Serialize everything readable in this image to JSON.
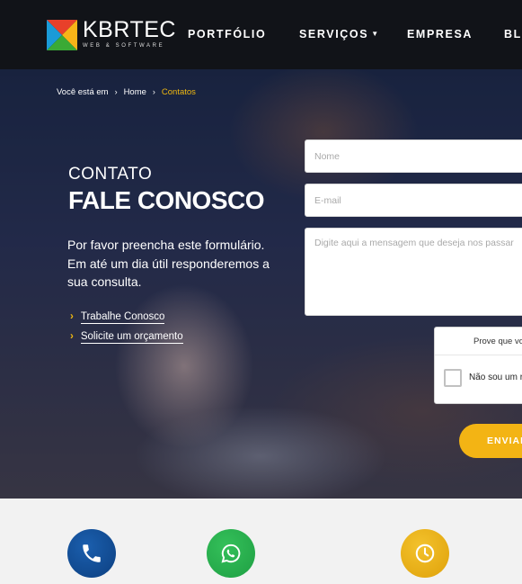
{
  "header": {
    "logo": {
      "name": "KBRTEC",
      "tagline": "WEB & SOFTWARE"
    },
    "nav": [
      {
        "label": "PORTFÓLIO"
      },
      {
        "label": "SERVIÇOS",
        "has_dropdown": true
      },
      {
        "label": "EMPRESA"
      },
      {
        "label": "BLO"
      }
    ]
  },
  "breadcrumb": {
    "prefix": "Você está em",
    "items": [
      "Home",
      "Contatos"
    ]
  },
  "intro": {
    "label": "CONTATO",
    "title": "FALE CONOSCO",
    "description": "Por favor preencha este formulário. Em até um dia útil responderemos a sua consulta.",
    "links": [
      "Trabalhe Conosco",
      "Solicite um orçamento"
    ]
  },
  "form": {
    "name_placeholder": "Nome",
    "email_placeholder": "E-mail",
    "message_placeholder": "Digite aqui a mensagem que deseja nos passar",
    "recaptcha_prompt": "Prove que vo",
    "recaptcha_label": "Não sou um r",
    "submit_label": "ENVIAR"
  },
  "info_icons": [
    {
      "icon": "phone-icon",
      "color": "#0c3f80"
    },
    {
      "icon": "whatsapp-icon",
      "color": "#1f9f43"
    },
    {
      "icon": "clock-icon",
      "color": "#dfa10a"
    }
  ],
  "colors": {
    "accent": "#f3b414",
    "breadcrumb_current": "#f0b810",
    "navbar": "#111318"
  }
}
